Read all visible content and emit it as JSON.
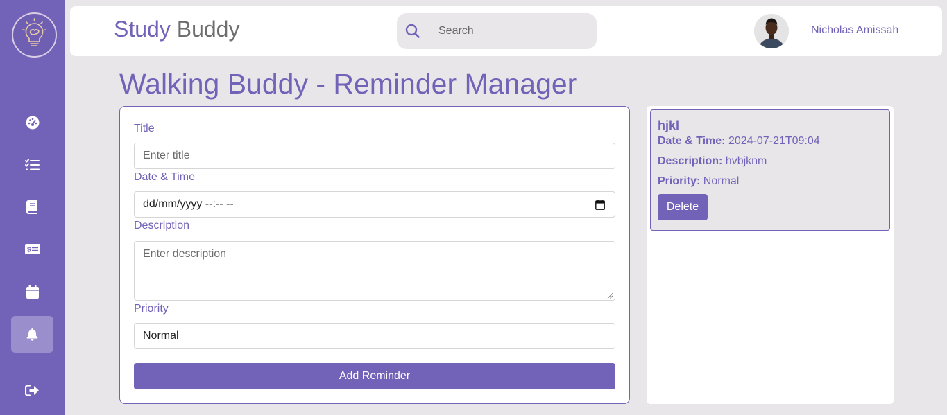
{
  "header": {
    "brand_part1": "Study",
    "brand_part2": " Buddy",
    "search_placeholder": "Search",
    "user_name": "Nicholas Amissah"
  },
  "sidebar": {
    "items": [
      {
        "icon": "dashboard-icon",
        "active": false
      },
      {
        "icon": "tasks-icon",
        "active": false
      },
      {
        "icon": "book-icon",
        "active": false
      },
      {
        "icon": "money-icon",
        "active": false
      },
      {
        "icon": "calendar-icon",
        "active": false
      },
      {
        "icon": "bell-icon",
        "active": true
      },
      {
        "icon": "logout-icon",
        "active": false
      }
    ]
  },
  "page": {
    "title": "Walking Buddy - Reminder Manager"
  },
  "form": {
    "title_label": "Title",
    "title_placeholder": "Enter title",
    "datetime_label": "Date & Time",
    "datetime_placeholder": "dd/mm/yyyy --:-- --",
    "description_label": "Description",
    "description_placeholder": "Enter description",
    "priority_label": "Priority",
    "priority_value": "Normal",
    "submit_label": "Add Reminder"
  },
  "reminders": [
    {
      "title": "hjkl",
      "datetime_label": "Date & Time:",
      "datetime_value": "2024-07-21T09:04",
      "description_label": "Description:",
      "description_value": "hvbjknm",
      "priority_label": "Priority:",
      "priority_value": "Normal",
      "delete_label": "Delete"
    }
  ],
  "colors": {
    "accent": "#7262b8",
    "sidebar_active": "#9a8fcc",
    "background": "#e8e6e8"
  }
}
